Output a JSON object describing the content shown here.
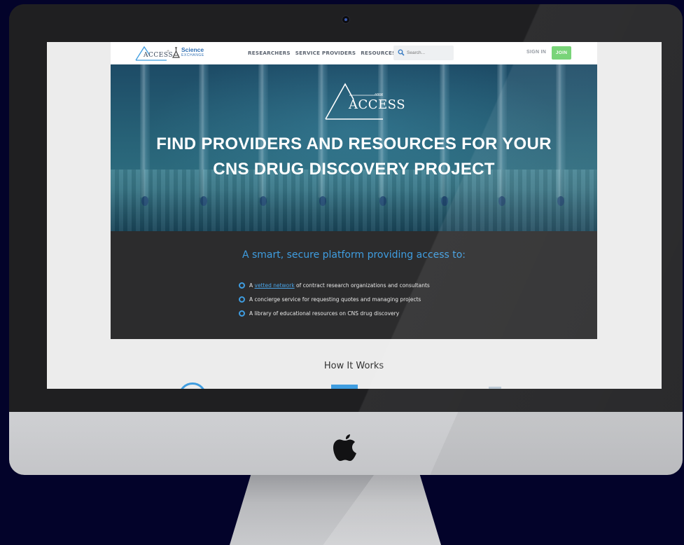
{
  "nav": {
    "logo_access": "ACCESS",
    "logo_plus": "+",
    "logo_science": "Science",
    "logo_exchange": "EXCHANGE",
    "links": [
      "RESEARCHERS",
      "SERVICE PROVIDERS",
      "RESOURCES"
    ],
    "search_placeholder": "Search...",
    "sign_in": "SIGN IN",
    "join": "JOIN"
  },
  "hero": {
    "logo_text": "ACCESS",
    "logo_small": "ADDF",
    "title": "FIND PROVIDERS AND RESOURCES FOR YOUR CNS DRUG DISCOVERY PROJECT"
  },
  "intro": {
    "title": "A smart, secure platform providing access to:",
    "bullet_1_prefix": "A ",
    "bullet_1_link": "vetted network",
    "bullet_1_suffix": " of contract research organizations and consultants",
    "bullet_2": "A concierge service for requesting quotes and managing projects",
    "bullet_3": "A library of educational resources on CNS drug discovery"
  },
  "how": {
    "title": "How It Works"
  },
  "colors": {
    "accent_blue": "#3f9de0",
    "join_green": "#6fd16f",
    "dark_section": "#2c2c2d",
    "background": "#03032a"
  }
}
